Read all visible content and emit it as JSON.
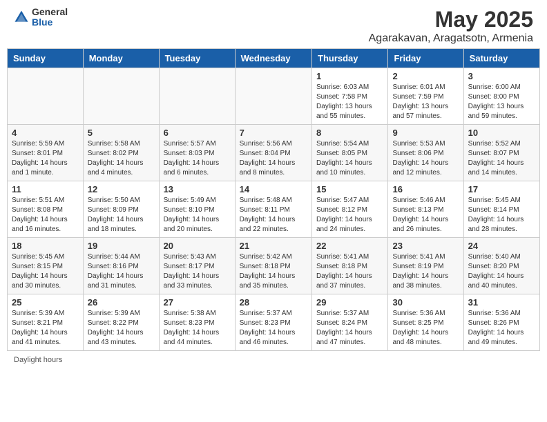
{
  "logo": {
    "general": "General",
    "blue": "Blue"
  },
  "title": "May 2025",
  "subtitle": "Agarakavan, Aragatsotn, Armenia",
  "days": [
    "Sunday",
    "Monday",
    "Tuesday",
    "Wednesday",
    "Thursday",
    "Friday",
    "Saturday"
  ],
  "weeks": [
    [
      {
        "num": "",
        "info": ""
      },
      {
        "num": "",
        "info": ""
      },
      {
        "num": "",
        "info": ""
      },
      {
        "num": "",
        "info": ""
      },
      {
        "num": "1",
        "info": "Sunrise: 6:03 AM\nSunset: 7:58 PM\nDaylight: 13 hours\nand 55 minutes."
      },
      {
        "num": "2",
        "info": "Sunrise: 6:01 AM\nSunset: 7:59 PM\nDaylight: 13 hours\nand 57 minutes."
      },
      {
        "num": "3",
        "info": "Sunrise: 6:00 AM\nSunset: 8:00 PM\nDaylight: 13 hours\nand 59 minutes."
      }
    ],
    [
      {
        "num": "4",
        "info": "Sunrise: 5:59 AM\nSunset: 8:01 PM\nDaylight: 14 hours\nand 1 minute."
      },
      {
        "num": "5",
        "info": "Sunrise: 5:58 AM\nSunset: 8:02 PM\nDaylight: 14 hours\nand 4 minutes."
      },
      {
        "num": "6",
        "info": "Sunrise: 5:57 AM\nSunset: 8:03 PM\nDaylight: 14 hours\nand 6 minutes."
      },
      {
        "num": "7",
        "info": "Sunrise: 5:56 AM\nSunset: 8:04 PM\nDaylight: 14 hours\nand 8 minutes."
      },
      {
        "num": "8",
        "info": "Sunrise: 5:54 AM\nSunset: 8:05 PM\nDaylight: 14 hours\nand 10 minutes."
      },
      {
        "num": "9",
        "info": "Sunrise: 5:53 AM\nSunset: 8:06 PM\nDaylight: 14 hours\nand 12 minutes."
      },
      {
        "num": "10",
        "info": "Sunrise: 5:52 AM\nSunset: 8:07 PM\nDaylight: 14 hours\nand 14 minutes."
      }
    ],
    [
      {
        "num": "11",
        "info": "Sunrise: 5:51 AM\nSunset: 8:08 PM\nDaylight: 14 hours\nand 16 minutes."
      },
      {
        "num": "12",
        "info": "Sunrise: 5:50 AM\nSunset: 8:09 PM\nDaylight: 14 hours\nand 18 minutes."
      },
      {
        "num": "13",
        "info": "Sunrise: 5:49 AM\nSunset: 8:10 PM\nDaylight: 14 hours\nand 20 minutes."
      },
      {
        "num": "14",
        "info": "Sunrise: 5:48 AM\nSunset: 8:11 PM\nDaylight: 14 hours\nand 22 minutes."
      },
      {
        "num": "15",
        "info": "Sunrise: 5:47 AM\nSunset: 8:12 PM\nDaylight: 14 hours\nand 24 minutes."
      },
      {
        "num": "16",
        "info": "Sunrise: 5:46 AM\nSunset: 8:13 PM\nDaylight: 14 hours\nand 26 minutes."
      },
      {
        "num": "17",
        "info": "Sunrise: 5:45 AM\nSunset: 8:14 PM\nDaylight: 14 hours\nand 28 minutes."
      }
    ],
    [
      {
        "num": "18",
        "info": "Sunrise: 5:45 AM\nSunset: 8:15 PM\nDaylight: 14 hours\nand 30 minutes."
      },
      {
        "num": "19",
        "info": "Sunrise: 5:44 AM\nSunset: 8:16 PM\nDaylight: 14 hours\nand 31 minutes."
      },
      {
        "num": "20",
        "info": "Sunrise: 5:43 AM\nSunset: 8:17 PM\nDaylight: 14 hours\nand 33 minutes."
      },
      {
        "num": "21",
        "info": "Sunrise: 5:42 AM\nSunset: 8:18 PM\nDaylight: 14 hours\nand 35 minutes."
      },
      {
        "num": "22",
        "info": "Sunrise: 5:41 AM\nSunset: 8:18 PM\nDaylight: 14 hours\nand 37 minutes."
      },
      {
        "num": "23",
        "info": "Sunrise: 5:41 AM\nSunset: 8:19 PM\nDaylight: 14 hours\nand 38 minutes."
      },
      {
        "num": "24",
        "info": "Sunrise: 5:40 AM\nSunset: 8:20 PM\nDaylight: 14 hours\nand 40 minutes."
      }
    ],
    [
      {
        "num": "25",
        "info": "Sunrise: 5:39 AM\nSunset: 8:21 PM\nDaylight: 14 hours\nand 41 minutes."
      },
      {
        "num": "26",
        "info": "Sunrise: 5:39 AM\nSunset: 8:22 PM\nDaylight: 14 hours\nand 43 minutes."
      },
      {
        "num": "27",
        "info": "Sunrise: 5:38 AM\nSunset: 8:23 PM\nDaylight: 14 hours\nand 44 minutes."
      },
      {
        "num": "28",
        "info": "Sunrise: 5:37 AM\nSunset: 8:23 PM\nDaylight: 14 hours\nand 46 minutes."
      },
      {
        "num": "29",
        "info": "Sunrise: 5:37 AM\nSunset: 8:24 PM\nDaylight: 14 hours\nand 47 minutes."
      },
      {
        "num": "30",
        "info": "Sunrise: 5:36 AM\nSunset: 8:25 PM\nDaylight: 14 hours\nand 48 minutes."
      },
      {
        "num": "31",
        "info": "Sunrise: 5:36 AM\nSunset: 8:26 PM\nDaylight: 14 hours\nand 49 minutes."
      }
    ]
  ],
  "note": "Daylight hours"
}
